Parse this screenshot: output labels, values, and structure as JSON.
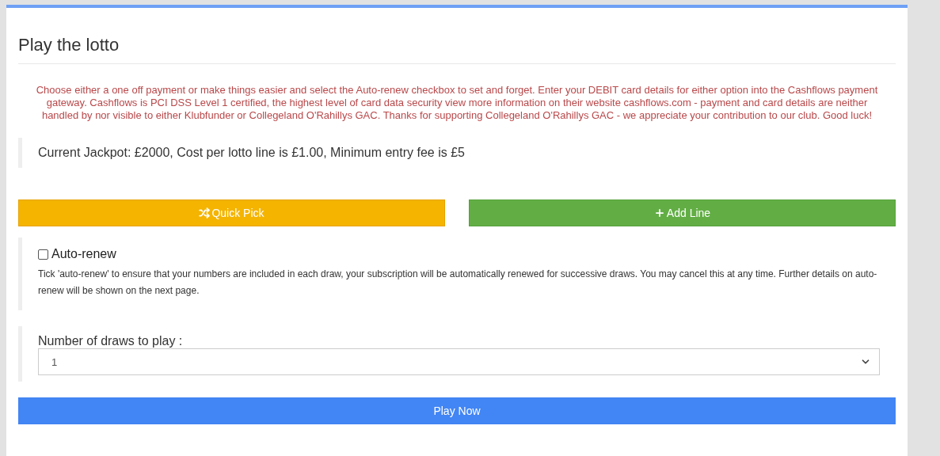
{
  "title": "Play the lotto",
  "notice": "Choose either a one off payment or make things easier and select the Auto-renew checkbox to set and forget. Enter your DEBIT card details for either option into the Cashflows payment gateway. Cashflows is PCI DSS Level 1 certified, the highest level of card data security view more information on their website cashflows.com - payment and card details are neither handled by nor visible to either Klubfunder or Collegeland O'Rahillys GAC. Thanks for supporting Collegeland O'Rahillys GAC - we appreciate your contribution to our club. Good luck!",
  "jackpot": "Current Jackpot: £2000, Cost per lotto line is £1.00, Minimum entry fee is £5",
  "actions": [
    {
      "kind": "shuffle",
      "label": "Quick Pick"
    },
    {
      "kind": "add",
      "label": "Add Line"
    }
  ],
  "auto_renew": {
    "label": "Auto-renew",
    "checked": false,
    "description": "Tick 'auto-renew' to ensure that your numbers are included in each draw, your subscription will be automatically renewed for successive draws. You may cancel this at any time. Further details on auto-renew will be shown on the next page."
  },
  "draws": {
    "label": "Number of draws to play :",
    "value": "1"
  },
  "submit": "Play Now"
}
